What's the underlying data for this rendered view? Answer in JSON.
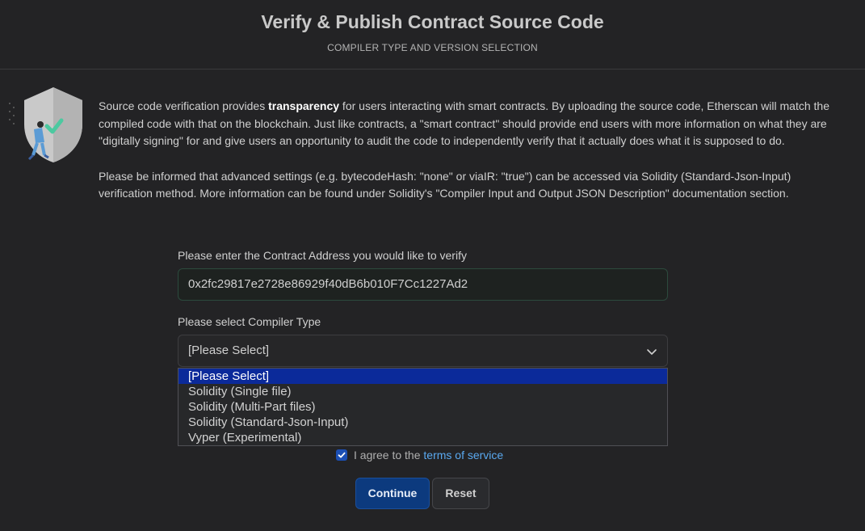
{
  "header": {
    "title": "Verify & Publish Contract Source Code",
    "subtitle": "COMPILER TYPE AND VERSION SELECTION"
  },
  "intro": {
    "p1_before": "Source code verification provides ",
    "p1_bold": "transparency",
    "p1_after": " for users interacting with smart contracts. By uploading the source code, Etherscan will match the compiled code with that on the blockchain. Just like contracts, a \"smart contract\" should provide end users with more information on what they are \"digitally signing\" for and give users an opportunity to audit the code to independently verify that it actually does what it is supposed to do.",
    "p2": "Please be informed that advanced settings (e.g. bytecodeHash: \"none\" or viaIR: \"true\") can be accessed via Solidity (Standard-Json-Input) verification method. More information can be found under Solidity's \"Compiler Input and Output JSON Description\" documentation section."
  },
  "form": {
    "address_label": "Please enter the Contract Address you would like to verify",
    "address_value": "0x2fc29817e2728e86929f40dB6b010F7Cc1227Ad2",
    "compiler_label": "Please select Compiler Type",
    "compiler_selected": "[Please Select]",
    "compiler_options": [
      "[Please Select]",
      "Solidity (Single file)",
      "Solidity (Multi-Part files)",
      "Solidity (Standard-Json-Input)",
      "Vyper (Experimental)"
    ],
    "agree_prefix": "I agree to the ",
    "agree_link": "terms of service",
    "agree_checked": true
  },
  "buttons": {
    "continue": "Continue",
    "reset": "Reset"
  },
  "colors": {
    "background": "#232325",
    "primary": "#0c3a7e",
    "link": "#5aa9f0",
    "check_accent": "#4cc9a0",
    "selected_option": "#0b2a9a"
  }
}
